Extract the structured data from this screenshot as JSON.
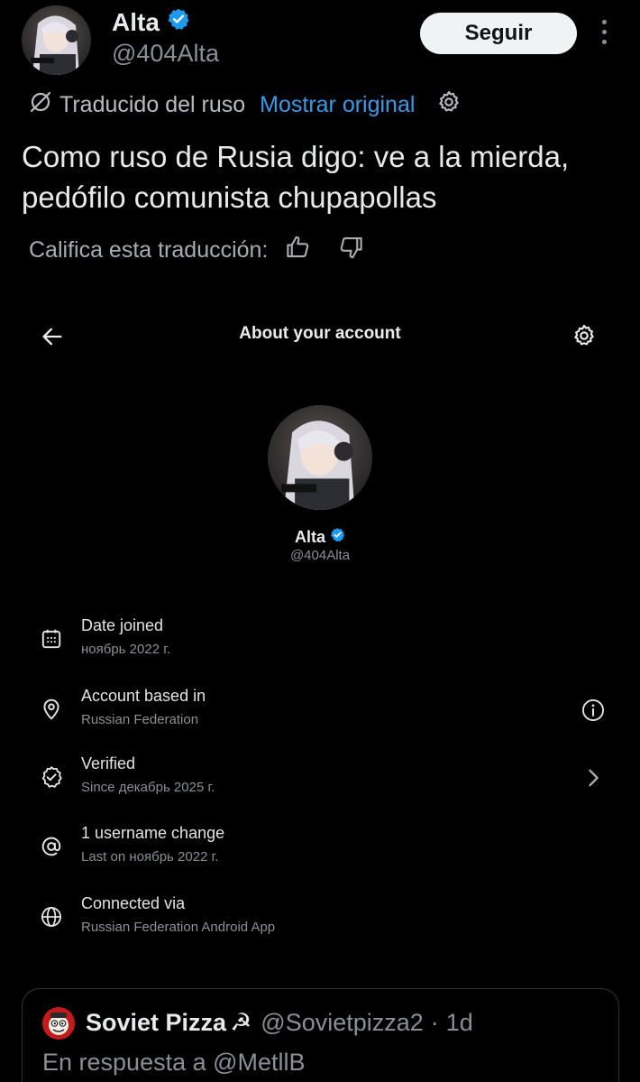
{
  "tweet": {
    "author_name": "Alta",
    "author_handle": "@404Alta",
    "follow_label": "Seguir",
    "translated_label": "Traducido del ruso",
    "show_original_label": "Mostrar original",
    "text": "Como ruso de Rusia digo: ve a la mierda, pedófilo comunista chupapollas",
    "rate_label": "Califica esta traducción:"
  },
  "about": {
    "title": "About your account",
    "name": "Alta",
    "handle": "@404Alta",
    "rows": [
      {
        "icon": "calendar-icon",
        "title": "Date joined",
        "subtitle": "ноябрь 2022 г."
      },
      {
        "icon": "location-pin-icon",
        "title": "Account based in",
        "subtitle": "Russian Federation",
        "trailing": "info-icon"
      },
      {
        "icon": "verified-badge-icon",
        "title": "Verified",
        "subtitle": "Since декабрь 2025 г.",
        "trailing": "chevron-right-icon"
      },
      {
        "icon": "at-sign-icon",
        "title": "1 username change",
        "subtitle": "Last on ноябрь 2022 г."
      },
      {
        "icon": "globe-icon",
        "title": "Connected via",
        "subtitle": "Russian Federation Android App"
      }
    ]
  },
  "quote": {
    "name": "Soviet Pizza",
    "symbol": "☭",
    "handle": "@Sovietpizza2",
    "separator": "·",
    "time": "1d",
    "reply_line": "En respuesta a @MetllB"
  },
  "colors": {
    "background": "#000000",
    "link_blue": "#3b9ae8",
    "verified_blue": "#1d9bf0",
    "text_primary": "#e7e9ea",
    "text_secondary": "#8b8f95"
  }
}
